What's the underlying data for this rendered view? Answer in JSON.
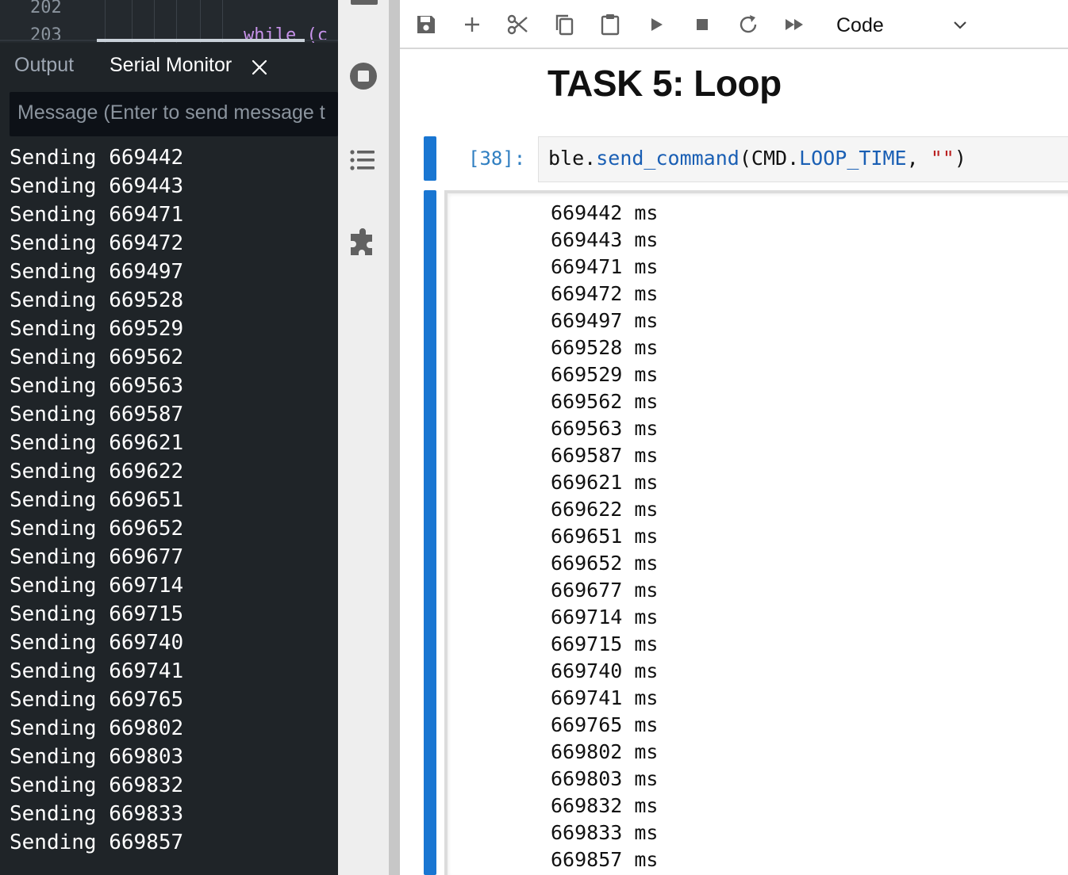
{
  "editor": {
    "line_numbers": [
      "202",
      "203"
    ],
    "code_fragment": "while (c"
  },
  "panel": {
    "tabs": [
      {
        "label": "Output"
      },
      {
        "label": "Serial Monitor"
      }
    ],
    "message_placeholder": "Message (Enter to send message t"
  },
  "serial_monitor": {
    "prefix": "Sending",
    "lines": [
      "669442",
      "669443",
      "669471",
      "669472",
      "669497",
      "669528",
      "669529",
      "669562",
      "669563",
      "669587",
      "669621",
      "669622",
      "669651",
      "669652",
      "669677",
      "669714",
      "669715",
      "669740",
      "669741",
      "669765",
      "669802",
      "669803",
      "669832",
      "669833",
      "669857"
    ]
  },
  "toolbar": {
    "buttons": [
      "save-icon",
      "add-icon",
      "cut-icon",
      "copy-icon",
      "paste-icon",
      "run-icon",
      "stop-icon",
      "restart-icon",
      "run-all-icon"
    ],
    "cell_type": "Code"
  },
  "notebook": {
    "heading": "TASK 5: Loop",
    "prompt": "[38]:",
    "code": {
      "obj": "ble",
      "dot1": ".",
      "fn": "send_command",
      "paren_open": "(",
      "cmd": "CMD",
      "dot2": ".",
      "attr": "LOOP_TIME",
      "comma": ", ",
      "str": "\"\"",
      "paren_close": ")"
    },
    "output_unit": "ms",
    "output_values": [
      "669442",
      "669443",
      "669471",
      "669472",
      "669497",
      "669528",
      "669529",
      "669562",
      "669563",
      "669587",
      "669621",
      "669622",
      "669651",
      "669652",
      "669677",
      "669714",
      "669715",
      "669740",
      "669741",
      "669765",
      "669802",
      "669803",
      "669832",
      "669833",
      "669857"
    ]
  },
  "colors": {
    "ide_bg": "#1f2428",
    "accent_blue": "#1976d2",
    "prompt_blue": "#307fc1",
    "string_red": "#ba2121"
  }
}
